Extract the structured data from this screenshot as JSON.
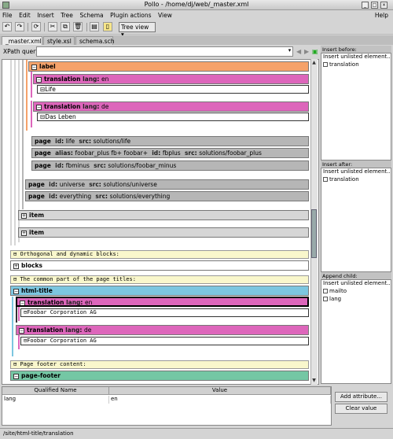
{
  "window": {
    "title": "Pollo - /home/dj/web/_master.xml"
  },
  "menu": {
    "items": [
      "File",
      "Edit",
      "Insert",
      "Tree",
      "Schema",
      "Plugin actions",
      "View"
    ],
    "help": "Help"
  },
  "toolbar": {
    "view_mode": "Tree view"
  },
  "tabs": [
    "_master.xml",
    "style.xsl",
    "schema.sch"
  ],
  "xpath": {
    "label": "XPath query:",
    "value": ""
  },
  "tree": {
    "label": "label",
    "tr1": {
      "name": "translation",
      "attr": "lang",
      "val": "en",
      "text": "Life"
    },
    "tr2": {
      "name": "translation",
      "attr": "lang",
      "val": "de",
      "text": "Das Leben"
    },
    "page1": {
      "name": "page",
      "a1": "id",
      "v1": "life",
      "a2": "src",
      "v2": "solutions/life"
    },
    "page2": {
      "name": "page",
      "a1": "alias",
      "v1": "foobar_plus fb+ foobar+",
      "a2": "id",
      "v2": "fbplus",
      "a3": "src",
      "v3": "solutions/foobar_plus"
    },
    "page3": {
      "name": "page",
      "a1": "id",
      "v1": "fbminus",
      "a2": "src",
      "v2": "solutions/foobar_minus"
    },
    "page4": {
      "name": "page",
      "a1": "id",
      "v1": "universe",
      "a2": "src",
      "v2": "solutions/universe"
    },
    "page5": {
      "name": "page",
      "a1": "id",
      "v1": "everything",
      "a2": "src",
      "v2": "solutions/everything"
    },
    "item1": "item",
    "item2": "item",
    "comment1": "Orthogonal and dynamic blocks:",
    "blocks": "blocks",
    "comment2": "The common part of the page titles:",
    "htmltitle": "html-title",
    "tr3": {
      "name": "translation",
      "attr": "lang",
      "val": "en",
      "text": "Foobar Corporation AG"
    },
    "tr4": {
      "name": "translation",
      "attr": "lang",
      "val": "de",
      "text": "Foobar Corporation AG"
    },
    "comment3": "Page footer content:",
    "pagefooter": "page-footer"
  },
  "right": {
    "insert_before": {
      "title": "Insert before:",
      "unlisted": "Insert unlisted element...",
      "opts": [
        "translation"
      ]
    },
    "insert_after": {
      "title": "Insert after:",
      "unlisted": "Insert unlisted element...",
      "opts": [
        "translation"
      ]
    },
    "append_child": {
      "title": "Append child:",
      "unlisted": "Insert unlisted element...",
      "opts": [
        "mailto",
        "lang"
      ]
    }
  },
  "attributes": {
    "headers": [
      "Qualified Name",
      "Value"
    ],
    "rows": [
      {
        "name": "lang",
        "value": "en"
      }
    ],
    "add_button": "Add attribute...",
    "clear_button": "Clear value"
  },
  "status": {
    "path": "/site/html-title/translation"
  },
  "colors": {
    "label": "#f5a26a",
    "translation": "#dd66bb",
    "page": "#b6b6b6",
    "item": "#d6d6d6",
    "htmltitle": "#7cc6e0",
    "footer": "#74c7a4",
    "comment": "#f9f7cc"
  }
}
